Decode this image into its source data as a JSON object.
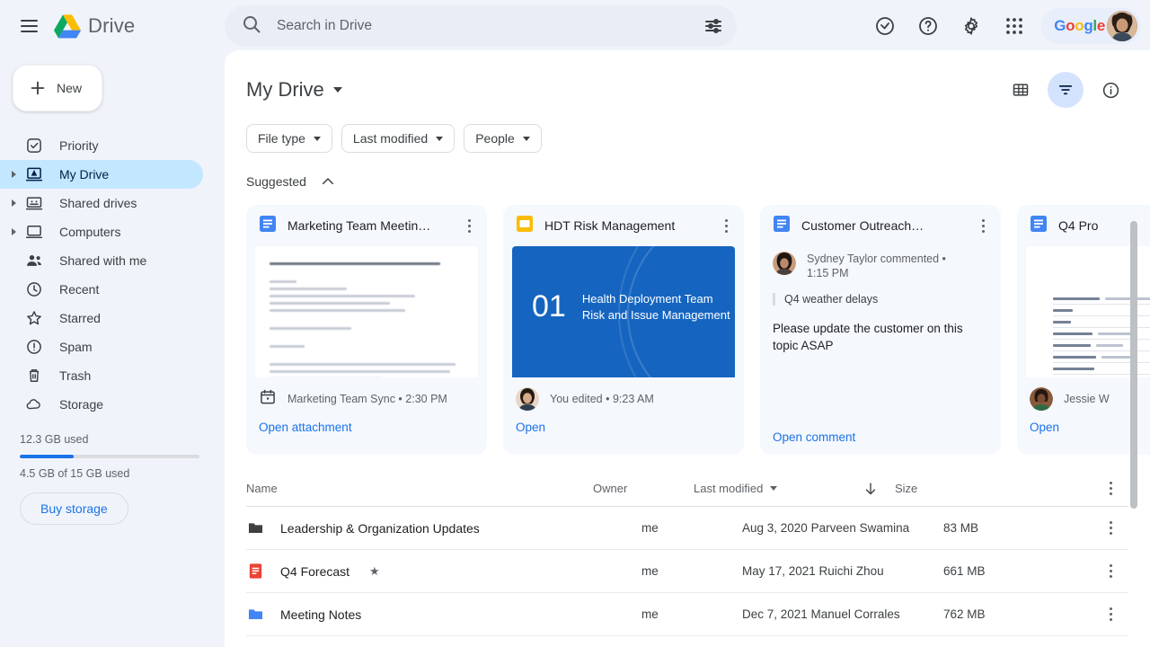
{
  "app": {
    "brand_name": "Drive",
    "menu_icon": "hamburger-icon",
    "logo_icon": "drive-logo-icon"
  },
  "search": {
    "placeholder": "Search in Drive",
    "value": "",
    "search_icon": "search-icon",
    "options_icon": "tune-icon"
  },
  "top_actions": {
    "items": [
      {
        "name": "status-icon",
        "label": "Status"
      },
      {
        "name": "help-icon",
        "label": "Support"
      },
      {
        "name": "gear-icon",
        "label": "Settings"
      },
      {
        "name": "apps-grid-icon",
        "label": "Google apps"
      }
    ],
    "account_word": "Google",
    "avatar": "user-avatar"
  },
  "sidebar": {
    "new_button": "New",
    "items": [
      {
        "label": "Priority",
        "icon": "check-circle-icon",
        "expandable": false,
        "active": false
      },
      {
        "label": "My Drive",
        "icon": "my-drive-icon",
        "expandable": true,
        "active": true
      },
      {
        "label": "Shared drives",
        "icon": "shared-drives-icon",
        "expandable": true,
        "active": false
      },
      {
        "label": "Computers",
        "icon": "computer-icon",
        "expandable": true,
        "active": false
      },
      {
        "label": "Shared with me",
        "icon": "people-icon",
        "expandable": false,
        "active": false
      },
      {
        "label": "Recent",
        "icon": "clock-icon",
        "expandable": false,
        "active": false
      },
      {
        "label": "Starred",
        "icon": "star-icon",
        "expandable": false,
        "active": false
      },
      {
        "label": "Spam",
        "icon": "spam-icon",
        "expandable": false,
        "active": false
      },
      {
        "label": "Trash",
        "icon": "trash-icon",
        "expandable": false,
        "active": false
      },
      {
        "label": "Storage",
        "icon": "cloud-icon",
        "expandable": false,
        "active": false
      }
    ],
    "storage_used": "12.3 GB used",
    "storage_quota": "4.5 GB of 15 GB used",
    "storage_percent": 30,
    "buy_storage": "Buy storage"
  },
  "main": {
    "title": "My Drive",
    "view_icons": [
      {
        "name": "grid-view-icon",
        "active": false
      },
      {
        "name": "filter-icon",
        "active": true
      },
      {
        "name": "info-icon",
        "active": false
      }
    ],
    "chips": [
      {
        "label": "File type"
      },
      {
        "label": "Last modified"
      },
      {
        "label": "People"
      }
    ],
    "suggested_label": "Suggested",
    "collapse_icon": "chevron-up-icon"
  },
  "cards": [
    {
      "type": "attachment",
      "file_icon": "google-docs-icon",
      "title": "Marketing Team Meetin…",
      "thumb": "doc-preview",
      "foot_icon": "calendar-icon",
      "foot_text": "Marketing Team Sync • 2:30 PM",
      "link": "Open attachment"
    },
    {
      "type": "slides",
      "file_icon": "google-slides-icon",
      "title": "HDT Risk Management",
      "thumb": "slide-preview",
      "slide_number": "01",
      "slide_line1": "Health Deployment Team",
      "slide_line2": "Risk and Issue Management",
      "foot_icon": "user-avatar",
      "foot_text": "You edited • 9:23 AM",
      "link": "Open"
    },
    {
      "type": "comment",
      "file_icon": "google-docs-icon",
      "title": "Customer Outreach…",
      "commenter": "Sydney Taylor commented •",
      "comment_time": "1:15 PM",
      "quote": "Q4 weather delays",
      "comment_text": "Please update the customer on this topic ASAP",
      "link": "Open comment"
    },
    {
      "type": "document",
      "file_icon": "google-docs-icon",
      "title": "Q4 Pro",
      "thumb": "table-preview",
      "thumb_rows": [
        "Proposal date & num",
        "Title",
        "Area",
        "Name of Proposal",
        "Geographical area",
        "Proposed starting",
        "Project duration",
        "Total Cost",
        "Project Scope"
      ],
      "foot_icon": "user-avatar",
      "foot_text": "Jessie W",
      "link": "Open"
    }
  ],
  "file_list": {
    "columns": {
      "name": "Name",
      "owner": "Owner",
      "last_modified": "Last modified",
      "size": "Size"
    },
    "sort_icon": "arrow-down-icon",
    "kebab_icon": "more-options-icon",
    "rows": [
      {
        "icon": "folder-dark-icon",
        "name": "Leadership & Organization Updates",
        "starred": false,
        "owner": "me",
        "modified": "Aug 3, 2020 Parveen Swamina",
        "size": "83 MB"
      },
      {
        "icon": "pdf-icon",
        "name": "Q4 Forecast",
        "starred": true,
        "owner": "me",
        "modified": "May 17, 2021 Ruichi Zhou",
        "size": "661 MB"
      },
      {
        "icon": "folder-blue-icon",
        "name": "Meeting Notes",
        "starred": false,
        "owner": "me",
        "modified": "Dec 7, 2021 Manuel Corrales",
        "size": "762 MB"
      }
    ]
  },
  "colors": {
    "accent_blue": "#1a73e8",
    "active_nav": "#c2e7ff",
    "active_icon_bg": "#d3e3fd",
    "card_bg": "#f5f8fd",
    "page_bg": "#f0f4fa",
    "slide_blue": "#1565c0",
    "pdf_red": "#ea4335"
  }
}
